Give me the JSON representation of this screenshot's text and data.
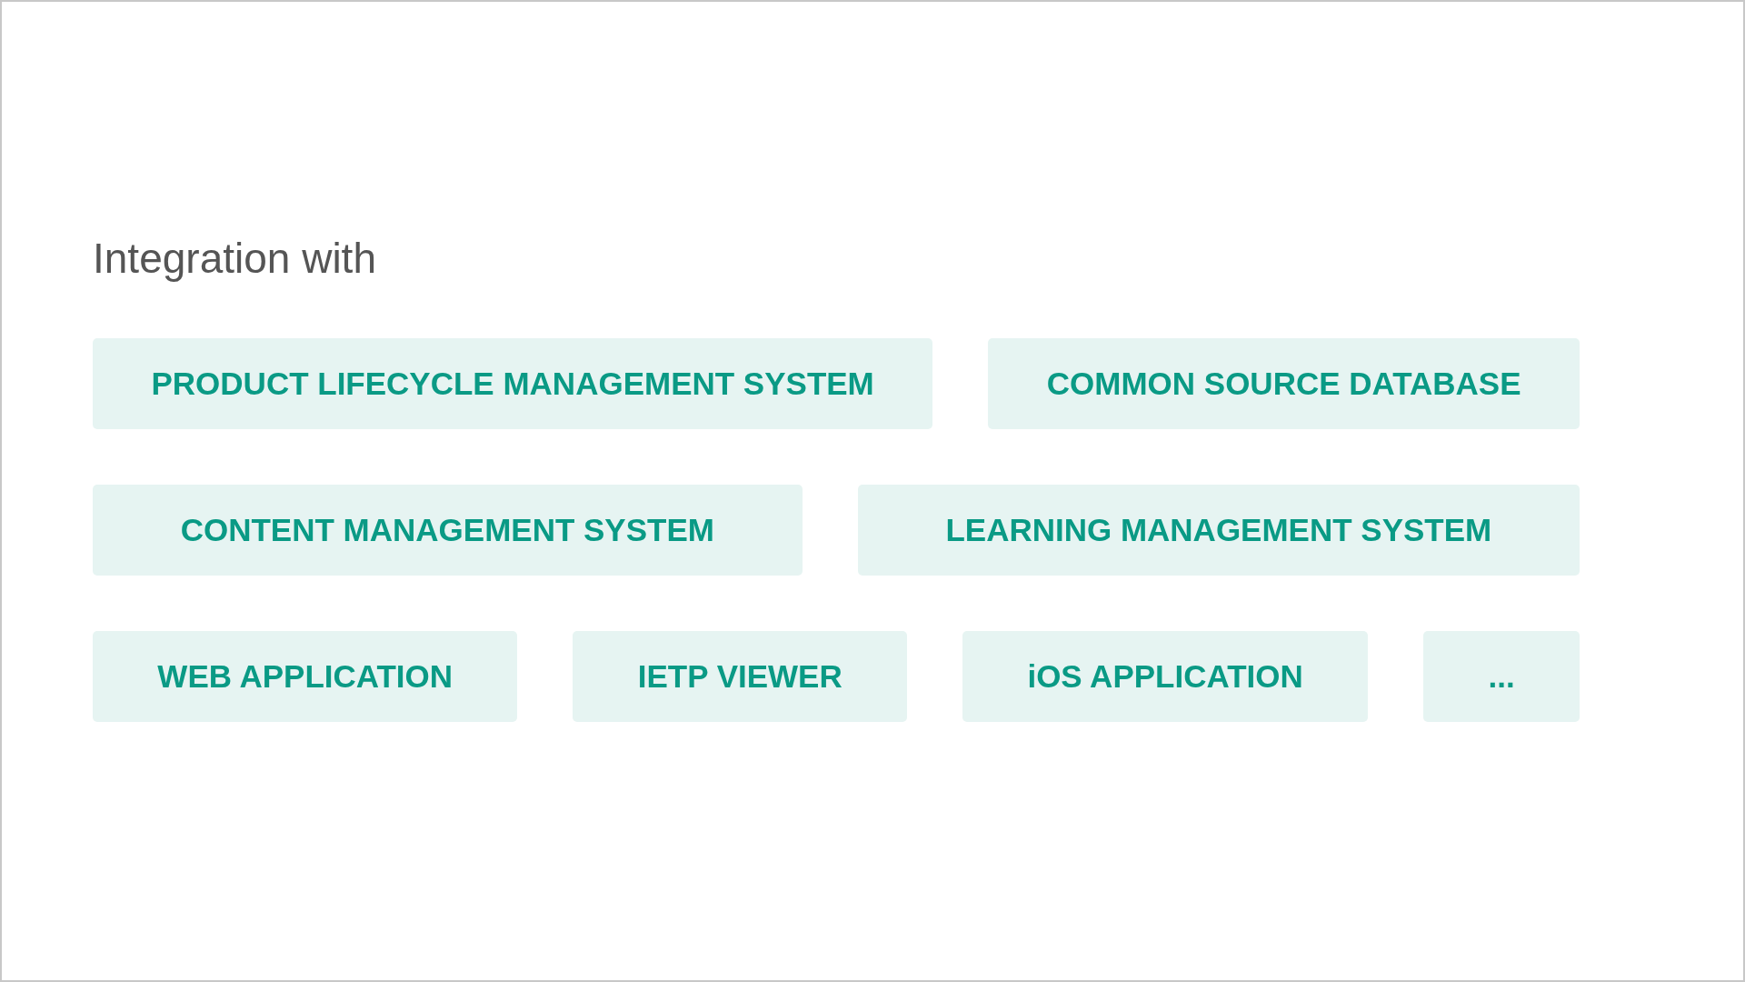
{
  "title": "Integration with",
  "rows": [
    [
      "PRODUCT LIFECYCLE MANAGEMENT SYSTEM",
      "COMMON SOURCE DATABASE"
    ],
    [
      "CONTENT MANAGEMENT SYSTEM",
      "LEARNING MANAGEMENT SYSTEM"
    ],
    [
      "WEB APPLICATION",
      "IETP VIEWER",
      "iOS APPLICATION",
      "..."
    ]
  ]
}
